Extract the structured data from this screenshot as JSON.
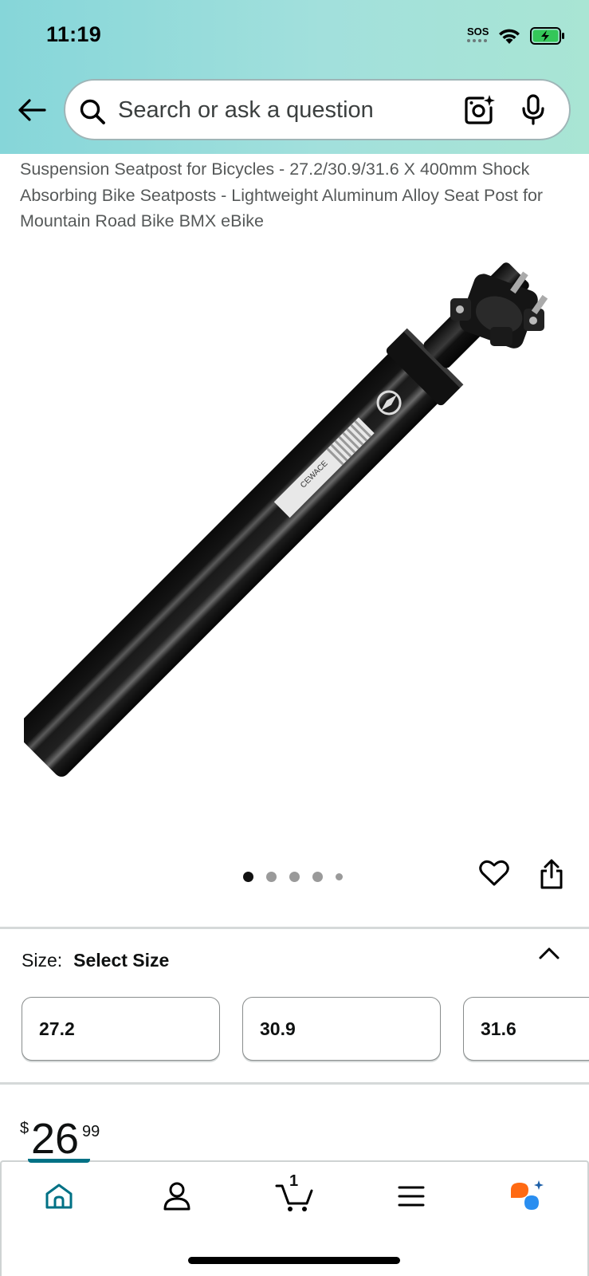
{
  "status_bar": {
    "time": "11:19",
    "sos": "SOS"
  },
  "search": {
    "placeholder": "Search or ask a question"
  },
  "product": {
    "title": "Suspension Seatpost for Bicycles - 27.2/30.9/31.6 X 400mm Shock Absorbing Bike Seatposts - Lightweight Aluminum Alloy Seat Post for Mountain Road Bike BMX eBike",
    "brand_mark": "CEWACE"
  },
  "carousel": {
    "total_images": 5,
    "active_index": 0
  },
  "size": {
    "label": "Size:",
    "selected": "Select Size",
    "options": [
      "27.2",
      "30.9",
      "31.6"
    ]
  },
  "price": {
    "currency": "$",
    "whole": "26",
    "fraction": "99"
  },
  "bottom_nav": {
    "items": [
      "home-icon",
      "account-icon",
      "cart-icon",
      "menu-icon",
      "rufus-icon"
    ],
    "cart_count": "1",
    "active": "home"
  },
  "colors": {
    "accent": "#007185",
    "header_start": "#86d6d9",
    "header_end": "#a9e5d4",
    "battery": "#34c759",
    "rufus_orange": "#ff6a13",
    "rufus_blue": "#2a8ef0"
  }
}
